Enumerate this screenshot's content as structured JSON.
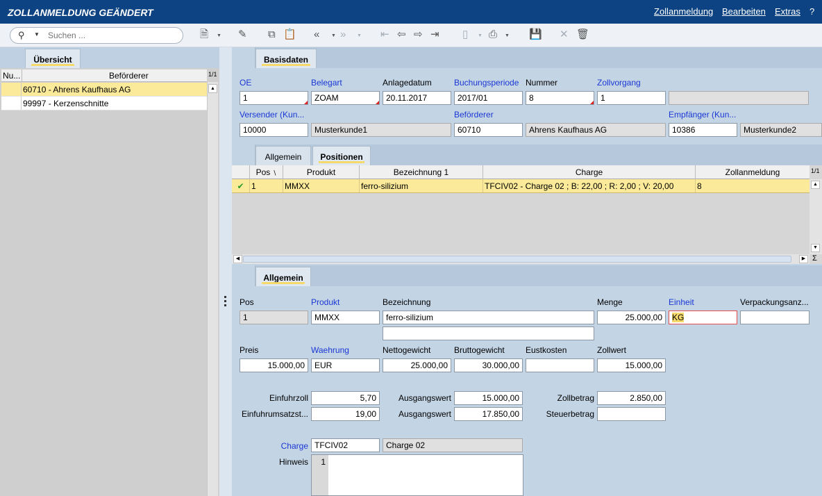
{
  "window": {
    "title": "ZOLLANMELDUNG GEÄNDERT",
    "menu": [
      "Zollanmeldung",
      "Bearbeiten",
      "Extras",
      "?"
    ]
  },
  "toolbar": {
    "search_placeholder": "Suchen ...",
    "icons": [
      "search-icon",
      "new-document-icon",
      "edit-icon",
      "copy-icon",
      "paste-icon",
      "back-double-icon",
      "forward-double-icon",
      "first-record-icon",
      "prev-record-icon",
      "next-record-icon",
      "last-record-icon",
      "report-icon",
      "print-icon",
      "save-icon",
      "cancel-icon",
      "delete-icon"
    ]
  },
  "left_panel": {
    "tab": "Übersicht",
    "columns": [
      "Nu...",
      "Beförderer"
    ],
    "pager": "1/1",
    "rows": [
      {
        "text": "60710 - Ahrens Kaufhaus AG",
        "selected": true
      },
      {
        "text": "99997 - Kerzenschnitte",
        "selected": false
      }
    ]
  },
  "header_section": {
    "tab": "Basisdaten",
    "labels": {
      "oe": "OE",
      "belegart": "Belegart",
      "anlagedatum": "Anlagedatum",
      "buchungsperiode": "Buchungsperiode",
      "nummer": "Nummer",
      "zollvorgang": "Zollvorgang",
      "versender": "Versender (Kun...",
      "befoerderer": "Beförderer",
      "empfaenger": "Empfänger (Kun..."
    },
    "values": {
      "oe": "1",
      "belegart": "ZOAM",
      "anlagedatum": "20.11.2017",
      "buchungsperiode": "2017/01",
      "nummer": "8",
      "zollvorgang": "1",
      "zollvorgang_text": "",
      "versender": "10000",
      "versender_name": "Musterkunde1",
      "befoerderer": "60710",
      "befoerderer_name": "Ahrens Kaufhaus AG",
      "empfaenger": "10386",
      "empfaenger_name": "Musterkunde2"
    }
  },
  "positions": {
    "tabs": [
      "Allgemein",
      "Positionen"
    ],
    "active_tab": "Positionen",
    "pager": "1/1",
    "sum_symbol": "Σ",
    "columns": [
      "Pos",
      "Produkt",
      "Bezeichnung 1",
      "Charge",
      "Zollanmeldung"
    ],
    "rows": [
      {
        "check": "✔",
        "pos": "1",
        "produkt": "MMXX",
        "bezeichnung": "ferro-silizium",
        "charge": "TFCIV02 - Charge 02 ; B: 22,00 ; R: 2,00 ; V: 20,00",
        "zollanmeldung": "8"
      }
    ]
  },
  "detail": {
    "tab": "Allgemein",
    "labels": {
      "pos": "Pos",
      "produkt": "Produkt",
      "bezeichnung": "Bezeichnung",
      "menge": "Menge",
      "einheit": "Einheit",
      "verpackung": "Verpackungsanz...",
      "preis": "Preis",
      "waehrung": "Waehrung",
      "nettogewicht": "Nettogewicht",
      "bruttogewicht": "Bruttogewicht",
      "eustkosten": "Eustkosten",
      "zollwert": "Zollwert",
      "einfuhrzoll": "Einfuhrzoll",
      "einfuhrumsatzst": "Einfuhrumsatzst...",
      "ausgangswert1": "Ausgangswert",
      "ausgangswert2": "Ausgangswert",
      "zollbetrag": "Zollbetrag",
      "steuerbetrag": "Steuerbetrag",
      "charge": "Charge",
      "hinweis": "Hinweis"
    },
    "values": {
      "pos": "1",
      "produkt": "MMXX",
      "bezeichnung": "ferro-silizium",
      "bezeichnung2": "",
      "menge": "25.000,00",
      "einheit": "KG",
      "verpackung": "",
      "preis": "15.000,00",
      "waehrung": "EUR",
      "nettogewicht": "25.000,00",
      "bruttogewicht": "30.000,00",
      "eustkosten": "",
      "zollwert": "15.000,00",
      "einfuhrzoll": "5,70",
      "einfuhrumsatzst": "19,00",
      "ausgangswert1": "15.000,00",
      "ausgangswert2": "17.850,00",
      "zollbetrag": "2.850,00",
      "steuerbetrag": "",
      "charge": "TFCIV02",
      "charge_name": "Charge 02",
      "hinweis_line": "1",
      "hinweis": ""
    }
  }
}
